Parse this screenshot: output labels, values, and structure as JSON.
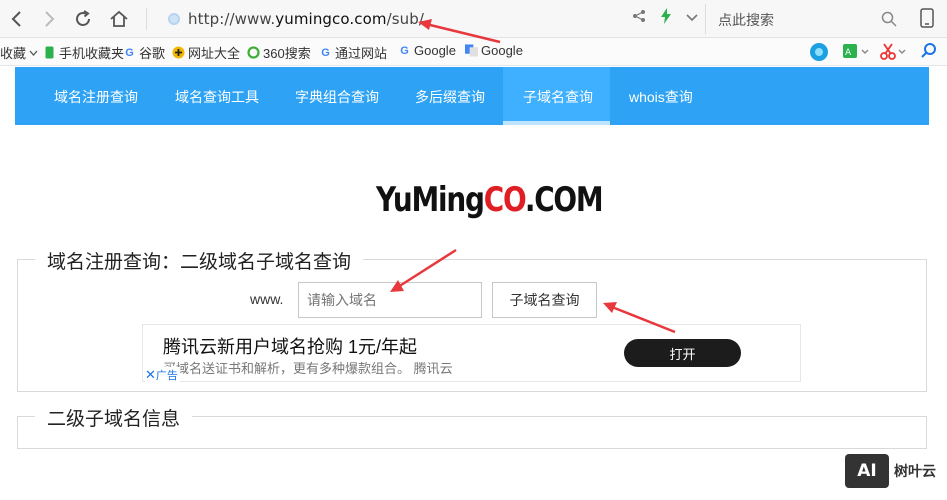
{
  "browser": {
    "url_prefix": "http://www.",
    "url_domain": "yumingco.com",
    "url_path": "/sub/",
    "search_placeholder": "点此搜索"
  },
  "bookmarks": [
    {
      "label": "收藏",
      "icon": "chevron-down-icon"
    },
    {
      "label": "手机收藏夹",
      "icon": "phone-icon"
    },
    {
      "label": "谷歌",
      "icon": "google-icon"
    },
    {
      "label": "网址大全",
      "icon": "plus-circle-icon"
    },
    {
      "label": "360搜索",
      "icon": "360-icon"
    },
    {
      "label": "通过网站",
      "icon": "google-icon"
    },
    {
      "label": "Google",
      "icon": "google-icon"
    },
    {
      "label": "Google",
      "icon": "translate-icon"
    }
  ],
  "site_nav": [
    {
      "label": "域名注册查询"
    },
    {
      "label": "域名查询工具"
    },
    {
      "label": "字典组合查询"
    },
    {
      "label": "多后缀查询"
    },
    {
      "label": "子域名查询",
      "active": true
    },
    {
      "label": "whois查询"
    }
  ],
  "logo": {
    "part1": "YuMing",
    "part2": "CO",
    "part3": ".COM"
  },
  "query_panel": {
    "legend": "域名注册查询：二级域名子域名查询",
    "prefix": "www.",
    "input_placeholder": "请输入域名",
    "button": "子域名查询"
  },
  "ad": {
    "title": "腾讯云新用户域名抢购 1元/年起",
    "subtitle": "买域名送证书和解析，更有多种爆款组合。 腾讯云",
    "button": "打开",
    "tag": "广告"
  },
  "info_panel": {
    "legend": "二级子域名信息"
  },
  "watermark": {
    "logo": "AI",
    "text": "树叶云"
  },
  "colors": {
    "nav_bg": "#2ea3f5",
    "arrow": "#e8383d"
  }
}
